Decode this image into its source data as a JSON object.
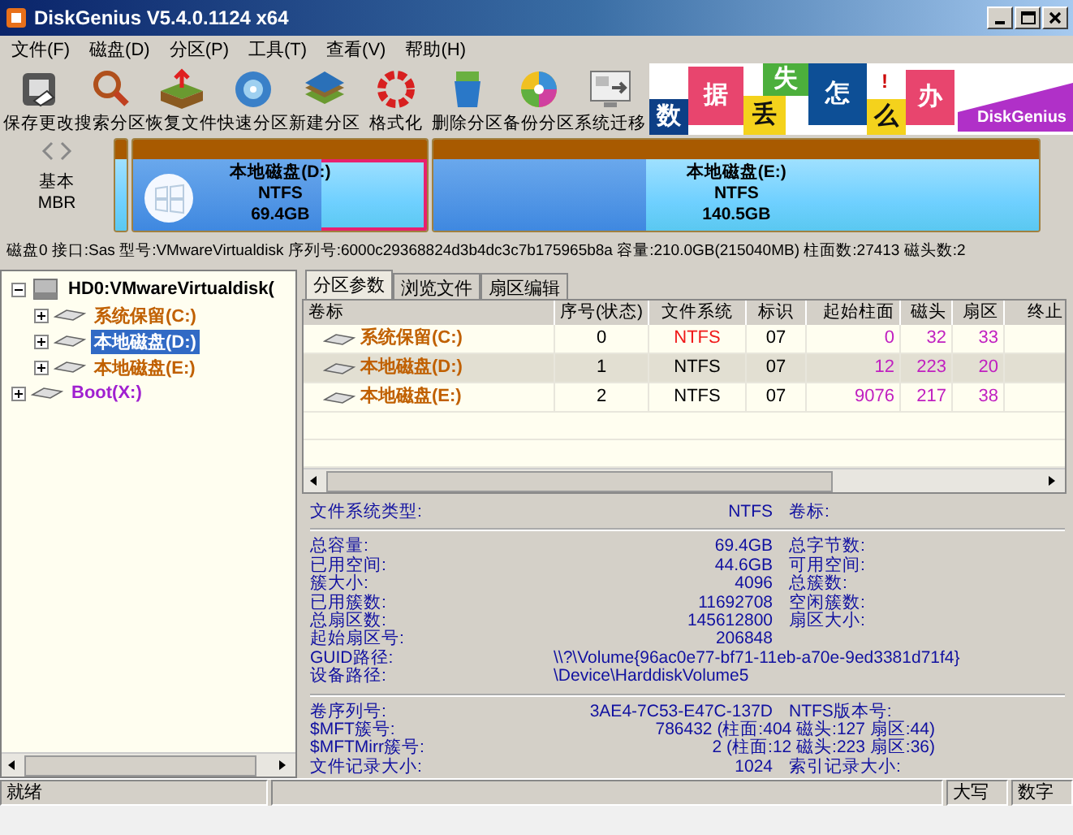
{
  "window": {
    "title": "DiskGenius V5.4.0.1124 x64"
  },
  "menu": [
    "文件(F)",
    "磁盘(D)",
    "分区(P)",
    "工具(T)",
    "查看(V)",
    "帮助(H)"
  ],
  "toolbar": [
    {
      "label": "保存更改",
      "kind": "save"
    },
    {
      "label": "搜索分区",
      "kind": "search"
    },
    {
      "label": "恢复文件",
      "kind": "recover"
    },
    {
      "label": "快速分区",
      "kind": "quick"
    },
    {
      "label": "新建分区",
      "kind": "new"
    },
    {
      "label": "格式化",
      "kind": "format"
    },
    {
      "label": "删除分区",
      "kind": "delete"
    },
    {
      "label": "备份分区",
      "kind": "backup"
    },
    {
      "label": "系统迁移",
      "kind": "migrate"
    }
  ],
  "banner": {
    "chars": [
      "数",
      "据",
      "丢",
      "失",
      "怎",
      "么",
      "办"
    ],
    "exclaim": "!",
    "brand": "DiskGenius"
  },
  "disk_map": {
    "type_lines": [
      "基本",
      "MBR"
    ],
    "partitions": [
      {
        "selected": false
      },
      {
        "name": "本地磁盘(D:)",
        "fs": "NTFS",
        "size": "69.4GB",
        "selected": true,
        "level": 0.64
      },
      {
        "name": "本地磁盘(E:)",
        "fs": "NTFS",
        "size": "140.5GB",
        "selected": false,
        "level": 0.35
      }
    ]
  },
  "disk_info": "磁盘0 接口:Sas  型号:VMwareVirtualdisk  序列号:6000c29368824d3b4dc3c7b175965b8a  容量:210.0GB(215040MB)  柱面数:27413  磁头数:2",
  "tree": [
    {
      "label": "HD0:VMwareVirtualdisk(",
      "kind": "disk",
      "selected": false,
      "expanded": true,
      "children": [
        {
          "label": "系统保留(C:)",
          "kind": "partition",
          "selected": false,
          "expanded": false
        },
        {
          "label": "本地磁盘(D:)",
          "kind": "partition",
          "selected": true,
          "expanded": false
        },
        {
          "label": "本地磁盘(E:)",
          "kind": "partition",
          "selected": false,
          "expanded": false
        }
      ]
    },
    {
      "label": "Boot(X:)",
      "kind": "boot",
      "selected": false,
      "expanded": false
    }
  ],
  "tabs": [
    {
      "label": "分区参数",
      "selected": true
    },
    {
      "label": "浏览文件",
      "selected": false
    },
    {
      "label": "扇区编辑",
      "selected": false
    }
  ],
  "table": {
    "columns": [
      "卷标",
      "序号(状态)",
      "文件系统",
      "标识",
      "起始柱面",
      "磁头",
      "扇区",
      "终止"
    ],
    "rows": [
      {
        "selected": false,
        "active": true,
        "cells": [
          "系统保留(C:)",
          "0",
          "NTFS",
          "07",
          "0",
          "32",
          "33"
        ]
      },
      {
        "selected": true,
        "active": false,
        "cells": [
          "本地磁盘(D:)",
          "1",
          "NTFS",
          "07",
          "12",
          "223",
          "20"
        ]
      },
      {
        "selected": false,
        "active": false,
        "cells": [
          "本地磁盘(E:)",
          "2",
          "NTFS",
          "07",
          "9076",
          "217",
          "38"
        ]
      }
    ]
  },
  "details": [
    [
      {
        "label": "文件系统类型:",
        "value": "NTFS",
        "label2": "卷标:",
        "kind": "plain"
      }
    ],
    [
      {
        "label": "总容量:",
        "value": "69.4GB",
        "label2": "总字节数:",
        "kind": "plain"
      },
      {
        "label": "已用空间:",
        "value": "44.6GB",
        "label2": "可用空间:",
        "kind": "plain"
      },
      {
        "label": "簇大小:",
        "value": "4096",
        "label2": "总簇数:",
        "kind": "plain"
      },
      {
        "label": "已用簇数:",
        "value": "11692708",
        "label2": "空闲簇数:",
        "kind": "plain"
      },
      {
        "label": "总扇区数:",
        "value": "145612800",
        "label2": "扇区大小:",
        "kind": "plain"
      },
      {
        "label": "起始扇区号:",
        "value": "206848",
        "kind": "plain"
      },
      {
        "label": "GUID路径:",
        "value": "\\\\?\\Volume{96ac0e77-bf71-11eb-a70e-9ed3381d71f4}",
        "kind": "path"
      },
      {
        "label": "设备路径:",
        "value": "\\Device\\HarddiskVolume5",
        "kind": "path"
      }
    ],
    [
      {
        "label": "卷序列号:",
        "value": "3AE4-7C53-E47C-137D",
        "label2": "NTFS版本号:",
        "kind": "plain"
      },
      {
        "label": "$MFT簇号:",
        "value": "786432 (柱面:404 磁头:127 扇区:44)",
        "kind": "wide"
      },
      {
        "label": "$MFTMirr簇号:",
        "value": "2 (柱面:12 磁头:223 扇区:36)",
        "kind": "wide"
      },
      {
        "label": "文件记录大小:",
        "value": "1024",
        "label2": "索引记录大小:",
        "kind": "plain"
      }
    ]
  ],
  "status_bar": {
    "message": "就绪",
    "indicators": [
      "大写",
      "数字"
    ]
  }
}
